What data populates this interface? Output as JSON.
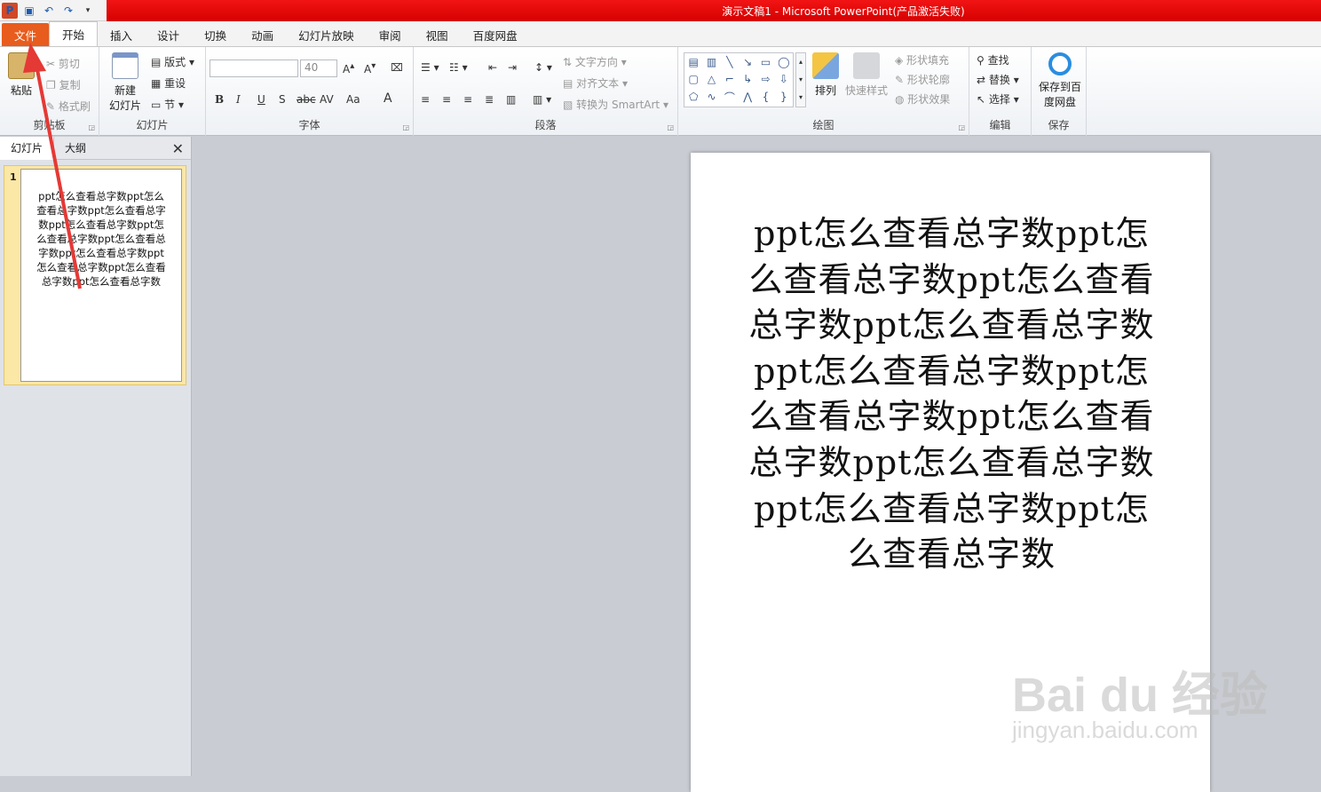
{
  "window": {
    "title": "演示文稿1 - Microsoft PowerPoint(产品激活失败)"
  },
  "qat": {
    "app_icon": "P"
  },
  "tabs": [
    "文件",
    "开始",
    "插入",
    "设计",
    "切换",
    "动画",
    "幻灯片放映",
    "审阅",
    "视图",
    "百度网盘"
  ],
  "ribbon": {
    "clipboard": {
      "paste": "粘贴",
      "cut": "剪切",
      "copy": "复制",
      "format_painter": "格式刷",
      "label": "剪贴板"
    },
    "slides": {
      "new_slide_1": "新建",
      "new_slide_2": "幻灯片",
      "layout": "版式",
      "reset": "重设",
      "section": "节",
      "label": "幻灯片"
    },
    "font": {
      "font_size": "40",
      "label": "字体"
    },
    "paragraph": {
      "text_direction": "文字方向",
      "align_text": "对齐文本",
      "smartart": "转换为 SmartArt",
      "label": "段落"
    },
    "drawing": {
      "arrange": "排列",
      "quick_styles": "快速样式",
      "shape_fill": "形状填充",
      "shape_outline": "形状轮廓",
      "shape_effects": "形状效果",
      "label": "绘图"
    },
    "editing": {
      "find": "查找",
      "replace": "替换",
      "select": "选择",
      "label": "编辑"
    },
    "save": {
      "save_baidu_1": "保存到百",
      "save_baidu_2": "度网盘",
      "label": "保存"
    }
  },
  "left_pane": {
    "tab_slides": "幻灯片",
    "tab_outline": "大纲",
    "close": "✕",
    "slide_number": "1"
  },
  "slide": {
    "text": "ppt怎么查看总字数ppt怎么查看总字数ppt怎么查看总字数ppt怎么查看总字数ppt怎么查看总字数ppt怎么查看总字数ppt怎么查看总字数ppt怎么查看总字数ppt怎么查看总字数ppt怎么查看总字数"
  },
  "watermark": {
    "brand": "Bai du 经验",
    "url": "jingyan.baidu.com"
  },
  "colors": {
    "file_tab": "#e85c1d",
    "title_bar": "#e81010",
    "arrow": "#e53935"
  }
}
